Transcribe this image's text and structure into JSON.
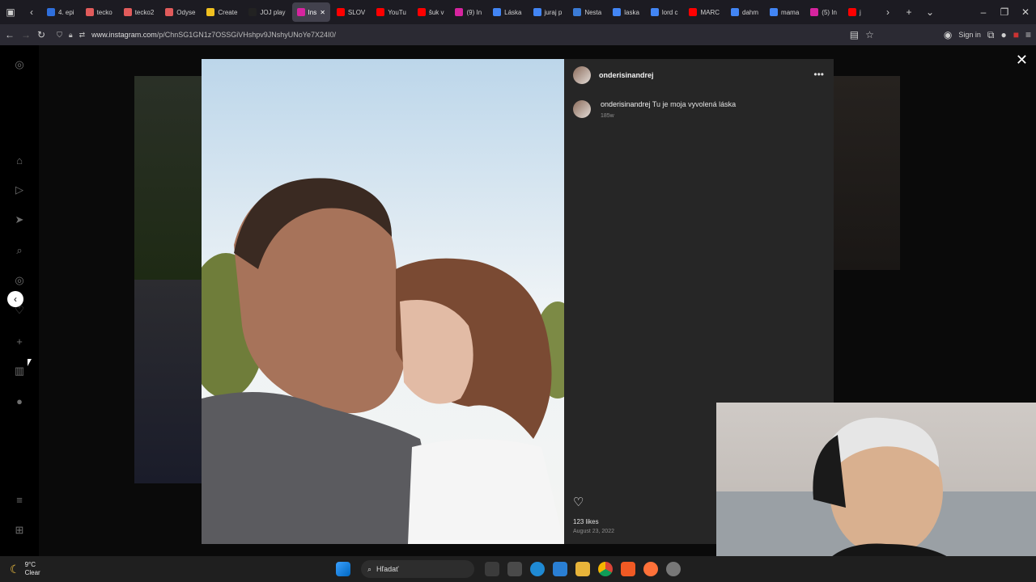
{
  "browser": {
    "tabs": [
      {
        "label": "4. epi",
        "color": "#2f6fdc"
      },
      {
        "label": "tecko",
        "color": "#e15b5b"
      },
      {
        "label": "tecko2",
        "color": "#e15b5b"
      },
      {
        "label": "Odyse",
        "color": "#e15b5b"
      },
      {
        "label": "Create",
        "color": "#f0c020"
      },
      {
        "label": "JOJ play",
        "color": "#222222"
      },
      {
        "label": "Ins",
        "color": "#d6249f",
        "active": true
      },
      {
        "label": "SLOV",
        "color": "#ff0000"
      },
      {
        "label": "YouTu",
        "color": "#ff0000"
      },
      {
        "label": "šuk v",
        "color": "#ff0000"
      },
      {
        "label": "(9) In",
        "color": "#d6249f"
      },
      {
        "label": "Láska",
        "color": "#4285f4"
      },
      {
        "label": "juraj p",
        "color": "#4285f4"
      },
      {
        "label": "Nesta",
        "color": "#3b7bd6"
      },
      {
        "label": "laska",
        "color": "#4285f4"
      },
      {
        "label": "lord c",
        "color": "#4285f4"
      },
      {
        "label": "MARC",
        "color": "#ff0000"
      },
      {
        "label": "dahm",
        "color": "#4285f4"
      },
      {
        "label": "mama",
        "color": "#4285f4"
      },
      {
        "label": "(5) In",
        "color": "#d6249f"
      },
      {
        "label": "j",
        "color": "#ff0000"
      }
    ],
    "url_host": "www.instagram.com",
    "url_path": "/p/ChnSG1GN1z7OSSGiVHshpv9JNshyUNoYe7X24I0/",
    "sign_in": "Sign in"
  },
  "post": {
    "username": "onderisinandrej",
    "caption_user": "onderisinandrej",
    "caption_text": "Tu je moja vyvolená láska",
    "caption_age": "185w",
    "likes": "123 likes",
    "date": "August 23, 2022"
  },
  "taskbar": {
    "weather_temp": "9°C",
    "weather_cond": "Clear",
    "search_placeholder": "Hľadať"
  }
}
